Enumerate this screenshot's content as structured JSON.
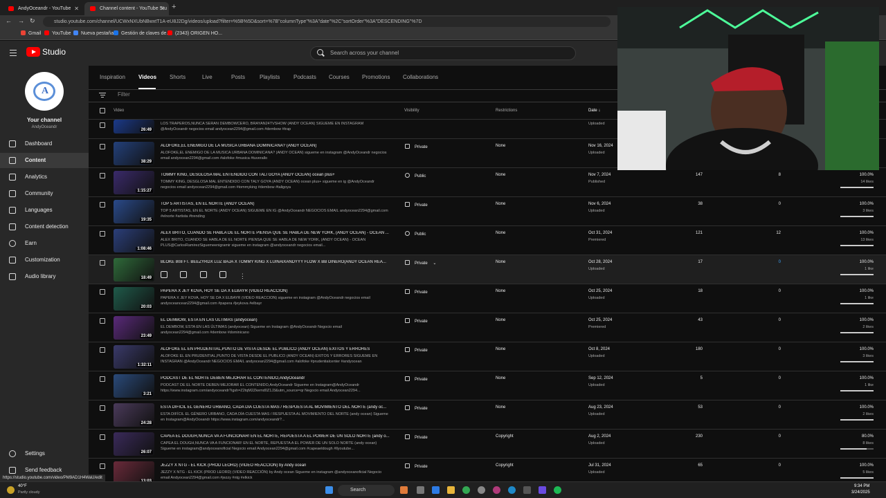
{
  "browser": {
    "tabs": [
      {
        "label": "AndyOceandr - YouTube"
      },
      {
        "label": "Channel content - YouTube Stu"
      }
    ],
    "url": "studio.youtube.com/channel/UCWxNXUbNBwxtT1A-eU8J2Dg/videos/upload?filter=%5B%5D&sort=%7B\"columnType\"%3A\"date\"%2C\"sortOrder\"%3A\"DESCENDING\"%7D",
    "bookmarks": [
      {
        "label": "Gmail",
        "color": "#ea4335"
      },
      {
        "label": "YouTube",
        "color": "#ff0000"
      },
      {
        "label": "Nueva pestaña",
        "color": "#4285f4"
      },
      {
        "label": "Gestión de claves de...",
        "color": "#1a73e8"
      },
      {
        "label": "(2343) ORIGEN HO...",
        "color": "#ff0000"
      }
    ],
    "status_url": "https://studio.youtube.com/video/PM9AD1H4WaU/edit"
  },
  "studio": {
    "logo_text": "Studio",
    "search_placeholder": "Search across your channel"
  },
  "sidebar": {
    "channel_title": "Your channel",
    "channel_handle": "AndyOceandr",
    "items": [
      {
        "label": "Dashboard"
      },
      {
        "label": "Content"
      },
      {
        "label": "Analytics"
      },
      {
        "label": "Community"
      },
      {
        "label": "Languages"
      },
      {
        "label": "Content detection"
      },
      {
        "label": "Earn"
      },
      {
        "label": "Customization"
      },
      {
        "label": "Audio library"
      }
    ],
    "bottom": [
      {
        "label": "Settings"
      },
      {
        "label": "Send feedback"
      }
    ]
  },
  "content_tabs": [
    "Inspiration",
    "Videos",
    "Shorts",
    "Live",
    "Posts",
    "Playlists",
    "Podcasts",
    "Courses",
    "Promotions",
    "Collaborations"
  ],
  "filter_label": "Filter",
  "table_headers": {
    "video": "Video",
    "visibility": "Visibility",
    "restrictions": "Restrictions",
    "date": "Date ↓"
  },
  "videos": [
    {
      "title": "",
      "desc": "LOS TRAPEROS,NUNCA SERAN DEMBOWCERO, BRAYAN24TVSHOW (ANDY OCEAN) SIGUEME EN INSTAGRAM @AndyOceandr negocios email andyocean2294@gmail.com #dembow #trap",
      "duration": "26:49",
      "visibility": "",
      "restrictions": "",
      "date": "",
      "status": "Uploaded",
      "views": "",
      "comments": "",
      "likes_pct": "",
      "likes": "",
      "thumb_color": "#1b3a8a"
    },
    {
      "title": "ALOFOKE,EL ENEMIGO DE LA MUSICA URBANA DOMINICANA? (ANDY OCEAN)",
      "desc": "ALOFOKE,EL ENEMIGO DE LA MUSICA URBANA DOMINICANA? (ANDY OCEAN) sigueme en instagram @AndyOceandr negocios email andyocean2294@gmail.com #alofoke #musica #tuverallo",
      "duration": "38:29",
      "visibility": "Private",
      "restrictions": "None",
      "date": "Nov 16, 2024",
      "status": "Uploaded",
      "views": "",
      "comments": "",
      "likes_pct": "",
      "likes": "",
      "thumb_color": "#23407a"
    },
    {
      "title": "TOMMY KING, DESGLOSA MAL ENTENDIDO CON TALI GOYA (ANDY OCEAN) ocean plus+",
      "desc": "TOMMY KING, DESGLOSA MAL ENTENDIDO CON TALY GOYA (ANDY OCEAN) ocean plus+ sigueme en ig @AndyOceandr negocios email andyocean2294@gmail.com #tommyking #dembow #taligoya",
      "duration": "1:15:27",
      "visibility": "Public",
      "restrictions": "None",
      "date": "Nov 7, 2024",
      "status": "Published",
      "views": "147",
      "comments": "8",
      "likes_pct": "100.0%",
      "likes": "14 likes",
      "thumb_color": "#3a2a6a"
    },
    {
      "title": "TOP 5 ARTISTAS, EN EL NORTE (ANDY OCEAN)",
      "desc": "TOP 5 ARTISTAS, EN EL NORTE (ANDY OCEAN) SIGUEME EN IG @AndyOceandr NEGOCIOS EMAIL andyocean2294@gmail.com #elnorte #artista #trending",
      "duration": "19:35",
      "visibility": "Private",
      "restrictions": "None",
      "date": "Nov 6, 2024",
      "status": "Uploaded",
      "views": "38",
      "comments": "0",
      "likes_pct": "100.0%",
      "likes": "3 likes",
      "thumb_color": "#2a4a8a"
    },
    {
      "title": "ALEX BRITO, CUANDO SE HABLA DE EL NORTE PIENSA QUE SE HABLA DE NEW YORK, (ANDY OCEAN) - OCEAN ...",
      "desc": "ALEX BRITO, CUANDO SE HABLA DE EL NORTE PIENSA QUE SE HABLA DE NEW YORK, (ANDY OCEAN) - OCEAN PLUS@CarlosRamirezSiguemeenigramir sigueme en instagram @andyoceandr negocios email...",
      "duration": "1:08:46",
      "visibility": "Public",
      "restrictions": "None",
      "date": "Oct 31, 2024",
      "status": "Premiered",
      "views": "121",
      "comments": "12",
      "likes_pct": "100.0%",
      "likes": "13 likes",
      "thumb_color": "#2b3f7a"
    },
    {
      "title": "BLOKE 808 FT. BEEZYRDX LUZ BAJA X TOMMY KING X LUINAIXANDYYY FLOW X BB DINERO(ANDY OCEAN REA...",
      "desc": "",
      "duration": "18:49",
      "visibility": "Private",
      "restrictions": "None",
      "date": "Oct 28, 2024",
      "status": "Uploaded",
      "views": "17",
      "comments": "0",
      "likes_pct": "100.0%",
      "likes": "1 like",
      "thumb_color": "#2f6a3a",
      "hover": true
    },
    {
      "title": "PAPERA X JEY KOVA, HOY SE DA X ELBAYR (VIDEO REACCION)",
      "desc": "PAPERA X JEY KOVA, HOY SE DA X ELBAYR (VIDEO REACCION) sigueme en instagram @AndyOceandr negocios email andyoceancean2294@gmail.com #papera #jeykova #elbayr",
      "duration": "20:03",
      "visibility": "Private",
      "restrictions": "None",
      "date": "Oct 25, 2024",
      "status": "Uploaded",
      "views": "18",
      "comments": "0",
      "likes_pct": "100.0%",
      "likes": "1 like",
      "thumb_color": "#1f5a4a"
    },
    {
      "title": "EL DEMBOW, ESTA EN LAS ÚLTIMAS (andyocean)",
      "desc": "EL DEMBOW, ESTA EN LAS ÚLTIMAS (andyocean) Sigueme en Instagram @AndyOceandr Negocio email andyocean2294@gmail.com #dembow #dominicano",
      "duration": "23:49",
      "visibility": "Private",
      "restrictions": "None",
      "date": "Oct 25, 2024",
      "status": "Premiered",
      "views": "43",
      "comments": "0",
      "likes_pct": "100.0%",
      "likes": "2 likes",
      "thumb_color": "#5a2a7a"
    },
    {
      "title": "ALOFOKE EL EN PRUDENTIAL,PUNTO DE VISTA DESDE EL PUBLICO (ANDY OCEAN) EXITOS Y ERRORES",
      "desc": "ALOFOKE EL EN PRUDENTIAL,PUNTO DE VISTA DESDE EL PUBLICO (ANDY OCEAN) EXITOS Y ERRORES SIGUEME EN INSTAGRAN @AndyOceandr NEGOCIOS EMAIL andyocean2294@gmail.com #alofoke #prudentialcenter #andyocean",
      "duration": "1:32:11",
      "visibility": "Private",
      "restrictions": "None",
      "date": "Oct 8, 2024",
      "status": "Uploaded",
      "views": "180",
      "comments": "0",
      "likes_pct": "100.0%",
      "likes": "3 likes",
      "thumb_color": "#3a3a6a"
    },
    {
      "title": "PODCAST DE EL NORTE DEBEN MEJORAR EL CONTENIDO,AndyOceandr",
      "desc": "PODCAST DE EL NORTE DEBEN MEJORAR EL CONTENIDO,AndyOceandr Sigueme en Instagram@AndyOceandr https://www.instagram.com/andyoceandr?igsh=Z2tqM2Zkemd0Z1J3&utm_source=qr Negocio email Andyocean2294...",
      "duration": "3:21",
      "visibility": "Private",
      "restrictions": "None",
      "date": "Sep 12, 2024",
      "status": "Uploaded",
      "views": "5",
      "comments": "0",
      "likes_pct": "100.0%",
      "likes": "1 like",
      "thumb_color": "#2a4a7a"
    },
    {
      "title": "ESTA DIFÍCIL EL GÉNERO URBANO, CADA DÍA CUESTA MAS / RESPUESTA AL MOVIMIENTO DEL NORTE (andy oc...",
      "desc": "ESTA DIFÍCIL EL GÉNERO URBANO, CADA DÍA CUESTA MAS / RESPUESTA AL MOVIMIENTO DEL NORTE (andy ocean) Sigueme en Instagram@AndyOceandr https://www.instagram.com/andyoceandr?...",
      "duration": "24:28",
      "visibility": "Private",
      "restrictions": "None",
      "date": "Aug 23, 2024",
      "status": "Uploaded",
      "views": "53",
      "comments": "0",
      "likes_pct": "100.0%",
      "likes": "2 likes",
      "thumb_color": "#4a3a5a"
    },
    {
      "title": "CAPEA EL DOUGH,NUNCA VA A FUNCIONAR! EN EL NORTE, REPUESTA A EL POWER DE UN SOLO NORTE (andy o...",
      "desc": "CAPEA EL DOUGH,NUNCA VA A FUNCIONAR! EN EL NORTE, REPUESTA A EL POWER DE UN SOLO NORTE (andy ocean) Sigueme en instagram@andyoceanoficial Negocio email Andyocean2294@gmail.com #capeaeldough #llyoutube...",
      "duration": "26:07",
      "visibility": "Private",
      "restrictions": "Copyright",
      "date": "Aug 2, 2024",
      "status": "Uploaded",
      "views": "230",
      "comments": "0",
      "likes_pct": "80.0%",
      "likes": "8 likes",
      "thumb_color": "#3a2a5a"
    },
    {
      "title": "JEZZY X NTG - EL KICK (PROD LEORD) (VIDEO REACCIÓN) by Andy ocean",
      "desc": "JEZZY X NTG - EL KICK (PROD LEORD) (VIDEO REACCIÓN) by Andy ocean Sigueme en instagram @andyoceanoficial Negocio email Andyocean2294@gmail.com #jezzy #ntg #elkick",
      "duration": "13:03",
      "visibility": "Private",
      "restrictions": "Copyright",
      "date": "Jul 31, 2024",
      "status": "Uploaded",
      "views": "65",
      "comments": "0",
      "likes_pct": "100.0%",
      "likes": "5 likes",
      "thumb_color": "#6a2a3a"
    }
  ],
  "taskbar": {
    "weather_temp": "40°F",
    "weather_desc": "Partly cloudy",
    "search_label": "Search",
    "time": "9:34 PM",
    "date": "3/24/2025"
  }
}
